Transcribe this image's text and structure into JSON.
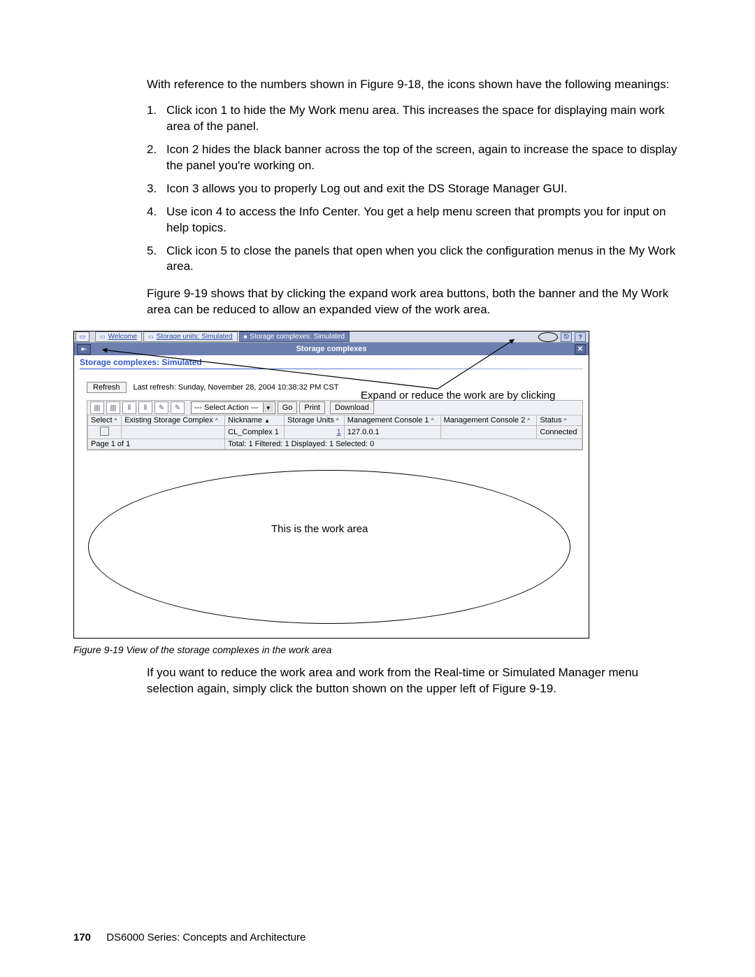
{
  "intro": "With reference to the numbers shown in Figure 9-18, the icons shown have the following meanings:",
  "list": [
    {
      "n": "1.",
      "t": "Click icon 1 to hide the My Work menu area. This increases the space for displaying main work area of the panel."
    },
    {
      "n": "2.",
      "t": "Icon 2 hides the black banner across the top of the screen, again to increase the space to display the panel you're working on."
    },
    {
      "n": "3.",
      "t": "Icon 3 allows you to properly Log out and exit the DS Storage Manager GUI."
    },
    {
      "n": "4.",
      "t": "Use icon 4 to access the Info Center. You get a help menu screen that prompts you for input on help topics."
    },
    {
      "n": "5.",
      "t": "Click icon 5 to close the panels that open when you click the configuration menus in the My Work area."
    }
  ],
  "after_list": "Figure 9-19 shows that by clicking the expand work area buttons, both the banner and the My Work area can be reduced to allow an expanded view of the work area.",
  "tabs": {
    "welcome": "Welcome",
    "storage_units": "Storage units: Simulated",
    "storage_complexes": "Storage complexes: Simulated"
  },
  "banner": "Storage complexes",
  "page_title": "Storage complexes: Simulated",
  "refresh": {
    "btn": "Refresh",
    "text": "Last refresh: Sunday, November 28, 2004 10:38:32 PM CST"
  },
  "annot_expand": "Expand or reduce the work are by clicking",
  "toolbar": {
    "select_action": "--- Select Action ---",
    "go": "Go",
    "print": "Print",
    "download": "Download"
  },
  "table": {
    "headers": [
      "Select",
      "Existing Storage Complex",
      "Nickname",
      "Storage Units",
      "Management Console 1",
      "Management Console 2",
      "Status"
    ],
    "row": {
      "nickname": "CL_Complex 1",
      "units": "1",
      "mc1": "127.0.0.1",
      "status": "Connected"
    },
    "footer_left": "Page 1 of 1",
    "footer_right": "Total: 1   Filtered: 1   Displayed: 1   Selected: 0"
  },
  "work_area_label": "This is the work area",
  "caption": "Figure 9-19   View of the storage complexes in the work area",
  "closing": "If you want to reduce the work area and work from the Real-time or Simulated Manager menu selection again, simply click the button shown on the upper left of Figure 9-19.",
  "footer": {
    "page": "170",
    "title": "DS6000 Series: Concepts and Architecture"
  }
}
